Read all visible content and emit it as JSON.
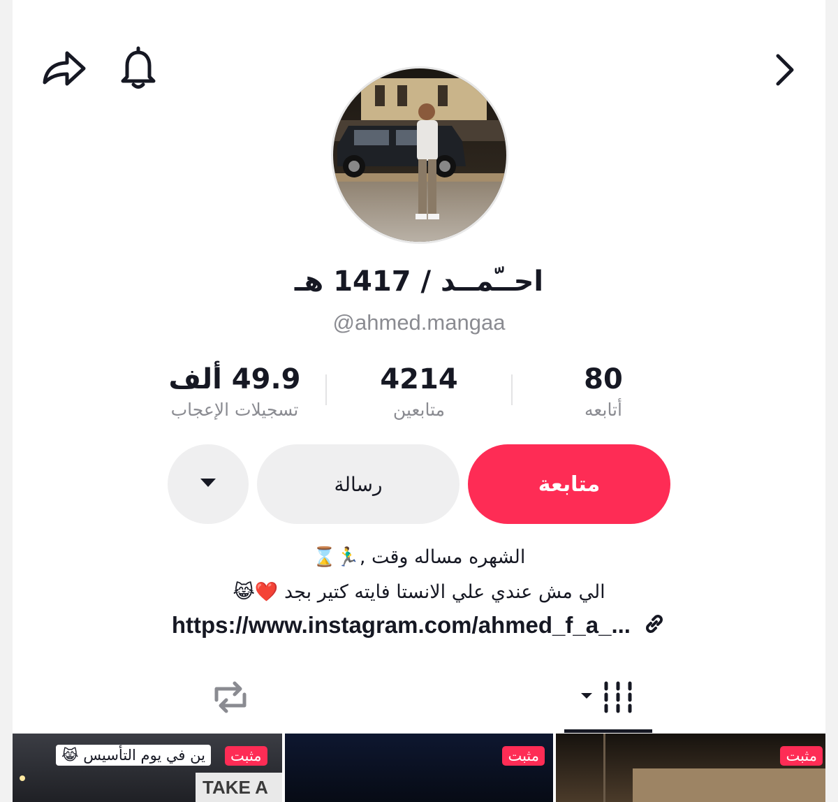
{
  "header": {
    "share_icon": "share-arrow-icon",
    "bell_icon": "bell-icon",
    "chevron_icon": "chevron-right-icon"
  },
  "profile": {
    "display_name": "احــّمــد / 1417 هـ",
    "username": "@ahmed.mangaa",
    "avatar_alt": "profile photo"
  },
  "stats": [
    {
      "value": "80",
      "label": "أتابعه"
    },
    {
      "value": "4214",
      "label": "متابعين"
    },
    {
      "value": "49.9 ألف",
      "label": "تسجيلات الإعجاب"
    }
  ],
  "actions": {
    "follow": "متابعة",
    "message": "رسالة",
    "more_icon": "triangle-down-icon"
  },
  "bio": {
    "line1": "الشهره مساله وقت ,🏃‍♂️⌛",
    "line2": "الي مش عندي علي الانستا فايته كتير بجد ❤️😹",
    "link": "https://www.instagram.com/ahmed_f_a_...",
    "link_icon": "link-icon"
  },
  "tabs": {
    "videos_icon": "grid-icon",
    "reposts_icon": "repost-icon"
  },
  "videos": [
    {
      "pinned_label": "مثبت",
      "caption": "ين في يوم التأسيس 😹",
      "sign_text": "TAKE A ST"
    },
    {
      "pinned_label": "مثبت"
    },
    {
      "pinned_label": "مثبت"
    }
  ],
  "colors": {
    "accent": "#fe2c55",
    "secondary_button": "#efeff0",
    "text_primary": "#161823",
    "text_secondary": "#8a8b91"
  }
}
